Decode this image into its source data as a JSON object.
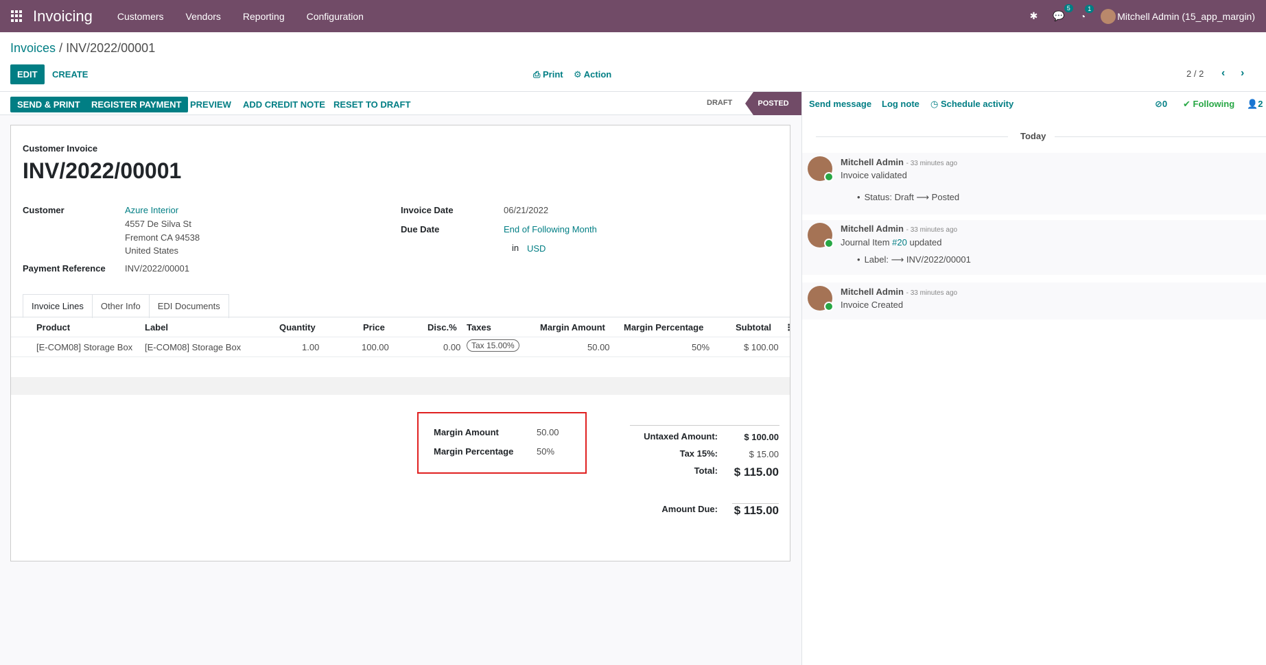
{
  "topbar": {
    "app_title": "Invoicing",
    "menu": [
      "Customers",
      "Vendors",
      "Reporting",
      "Configuration"
    ],
    "messages_badge": "5",
    "activities_badge": "1",
    "user": "Mitchell Admin (15_app_margin)"
  },
  "control_panel": {
    "breadcrumb_parent": "Invoices",
    "breadcrumb_sep": "/",
    "breadcrumb_current": "INV/2022/00001",
    "edit": "EDIT",
    "create": "CREATE",
    "print": "Print",
    "action": "Action",
    "pager": "2 / 2"
  },
  "statusbar": {
    "send_print": "SEND & PRINT",
    "register_payment": "REGISTER PAYMENT",
    "preview": "PREVIEW",
    "add_credit_note": "ADD CREDIT NOTE",
    "reset_to_draft": "RESET TO DRAFT",
    "stage_draft": "DRAFT",
    "stage_posted": "POSTED"
  },
  "invoice": {
    "type": "Customer Invoice",
    "name": "INV/2022/00001",
    "customer_label": "Customer",
    "customer_name": "Azure Interior",
    "address_line1": "4557 De Silva St",
    "address_line2": "Fremont CA 94538",
    "address_line3": "United States",
    "payment_ref_label": "Payment Reference",
    "payment_ref": "INV/2022/00001",
    "invoice_date_label": "Invoice Date",
    "invoice_date": "06/21/2022",
    "due_date_label": "Due Date",
    "due_date": "End of Following Month",
    "currency_in": "in",
    "currency": "USD"
  },
  "tabs": [
    "Invoice Lines",
    "Other Info",
    "EDI Documents"
  ],
  "lines": {
    "headers": {
      "product": "Product",
      "label": "Label",
      "quantity": "Quantity",
      "price": "Price",
      "disc": "Disc.%",
      "taxes": "Taxes",
      "margin_amount": "Margin Amount",
      "margin_percentage": "Margin Percentage",
      "subtotal": "Subtotal"
    },
    "rows": [
      {
        "product": "[E-COM08] Storage Box",
        "label": "[E-COM08] Storage Box",
        "quantity": "1.00",
        "price": "100.00",
        "disc": "0.00",
        "tax": "Tax 15.00%",
        "margin_amount": "50.00",
        "margin_percentage": "50%",
        "subtotal": "$ 100.00"
      }
    ]
  },
  "margin": {
    "amount_label": "Margin Amount",
    "amount": "50.00",
    "percentage_label": "Margin Percentage",
    "percentage": "50%"
  },
  "totals": {
    "untaxed_label": "Untaxed Amount:",
    "untaxed": "$ 100.00",
    "tax_label": "Tax 15%:",
    "tax": "$ 15.00",
    "total_label": "Total:",
    "total": "$ 115.00",
    "amount_due_label": "Amount Due:",
    "amount_due": "$ 115.00"
  },
  "chatter": {
    "send_message": "Send message",
    "log_note": "Log note",
    "schedule_activity": "Schedule activity",
    "attachments": "0",
    "following": "Following",
    "followers": "2",
    "today": "Today",
    "messages": [
      {
        "author": "Mitchell Admin",
        "time": "- 33 minutes ago",
        "body": "Invoice validated",
        "detail": "Status: Draft ⟶ Posted"
      },
      {
        "author": "Mitchell Admin",
        "time": "- 33 minutes ago",
        "body_prefix": "Journal Item ",
        "body_link": "#20",
        "body_suffix": " updated",
        "detail": "Label: ⟶ INV/2022/00001"
      },
      {
        "author": "Mitchell Admin",
        "time": "- 33 minutes ago",
        "body": "Invoice Created"
      }
    ]
  },
  "colors": {
    "brand": "#714b67",
    "accent": "#017e84",
    "highlight_box": "#e02020"
  }
}
